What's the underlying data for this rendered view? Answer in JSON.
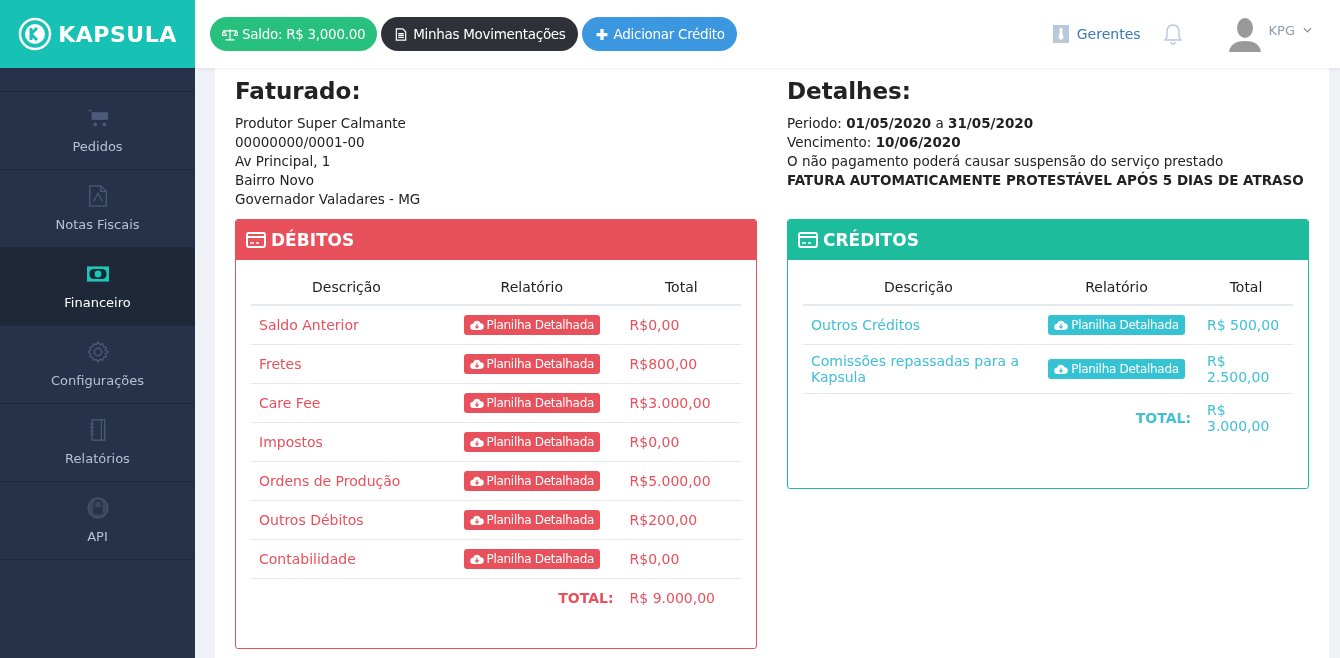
{
  "brand": {
    "name": "KAPSULA"
  },
  "header": {
    "buttons": [
      {
        "kind": "balance",
        "label": "Saldo: R$ 3,000.00"
      },
      {
        "kind": "statement",
        "label": "Minhas Movimentações"
      },
      {
        "kind": "add",
        "label": "Adicionar Crédito"
      }
    ],
    "managers_link": "Gerentes",
    "user": "KPG"
  },
  "sidebar": {
    "items": [
      {
        "label": "Pedidos",
        "selected": false
      },
      {
        "label": "Notas Fiscais",
        "selected": false
      },
      {
        "label": "Financeiro",
        "selected": true
      },
      {
        "label": "Configurações",
        "selected": false
      },
      {
        "label": "Relatórios",
        "selected": false
      },
      {
        "label": "API",
        "selected": false
      }
    ]
  },
  "billed": {
    "title": "Faturado:",
    "lines": [
      "Produtor Super Calmante",
      "00000000/0001-00",
      "Av Principal, 1",
      "Bairro Novo",
      "Governador Valadares - MG"
    ]
  },
  "details": {
    "title": "Detalhes:",
    "lines": [
      {
        "text": "Periodo: **01/05/2020** a **31/05/2020**",
        "strong": false
      },
      {
        "text": "Vencimento: **10/06/2020**",
        "strong": false
      },
      {
        "text": "O não pagamento poderá causar suspensão do serviço prestado",
        "strong": false
      },
      {
        "text": "FATURA AUTOMATICAMENTE PROTESTÁVEL APÓS 5 DIAS DE ATRASO",
        "strong": true
      }
    ]
  },
  "panels": [
    {
      "kind": "debit",
      "title": "DÉBITOS",
      "columns": [
        "Descrição",
        "Relatório",
        "Total"
      ],
      "rows": [
        {
          "description": "Saldo Anterior",
          "report": "Planilha Detalhada",
          "total": "R$0,00"
        },
        {
          "description": "Fretes",
          "report": "Planilha Detalhada",
          "total": "R$800,00"
        },
        {
          "description": "Care Fee",
          "report": "Planilha Detalhada",
          "total": "R$3.000,00"
        },
        {
          "description": "Impostos",
          "report": "Planilha Detalhada",
          "total": "R$0,00"
        },
        {
          "description": "Ordens de Produção",
          "report": "Planilha Detalhada",
          "total": "R$5.000,00"
        },
        {
          "description": "Outros Débitos",
          "report": "Planilha Detalhada",
          "total": "R$200,00"
        },
        {
          "description": "Contabilidade",
          "report": "Planilha Detalhada",
          "total": "R$0,00"
        }
      ],
      "total_label": "TOTAL:",
      "total": "R$ 9.000,00"
    },
    {
      "kind": "credit",
      "title": "CRÉDITOS",
      "columns": [
        "Descrição",
        "Relatório",
        "Total"
      ],
      "rows": [
        {
          "description": "Outros Créditos",
          "report": "Planilha Detalhada",
          "total": "R$ 500,00"
        },
        {
          "description": "Comissões repassadas para a Kapsula",
          "report": "Planilha Detalhada",
          "total": "R$ 2.500,00"
        }
      ],
      "total_label": "TOTAL:",
      "total": "R$ 3.000,00"
    }
  ]
}
